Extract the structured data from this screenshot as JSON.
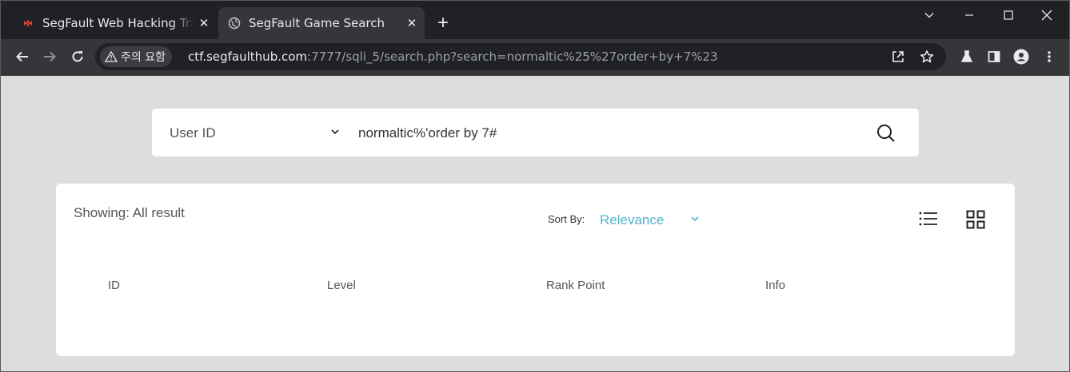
{
  "browser": {
    "tabs": [
      {
        "title": "SegFault Web Hacking Trai",
        "close": "✕"
      },
      {
        "title": "SegFault Game Search",
        "close": "✕"
      }
    ],
    "new_tab": "+",
    "security_chip": "주의 요함",
    "url_host": "ctf.segfaulthub.com",
    "url_rest": ":7777/sqli_5/search.php?search=normaltic%25%27order+by+7%23"
  },
  "search": {
    "field_select": "User ID",
    "query": "normaltic%'order by 7#"
  },
  "results": {
    "showing": "Showing: All result",
    "sort_label": "Sort By:",
    "sort_value": "Relevance",
    "columns": [
      "ID",
      "Level",
      "Rank Point",
      "Info"
    ]
  },
  "colors": {
    "accent": "#4fb3cc",
    "tabstrip": "#202124",
    "toolbar": "#35363a",
    "page_bg": "#dddddd"
  }
}
